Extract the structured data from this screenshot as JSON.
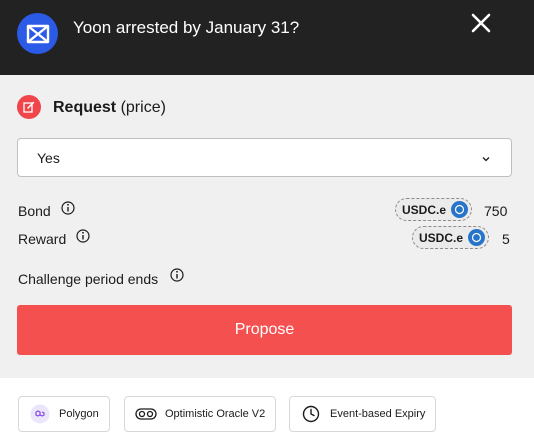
{
  "header": {
    "title": "Yoon arrested by January 31?",
    "logo_icon": "uma-logo-icon",
    "close_icon": "close-icon"
  },
  "request": {
    "label_bold": "Request",
    "label_rest": "(price)",
    "icon": "edit-icon"
  },
  "answer_select": {
    "value": "Yes",
    "icon": "chevron-down-icon"
  },
  "bond": {
    "label": "Bond",
    "token": "USDC.e",
    "amount": "750"
  },
  "reward": {
    "label": "Reward",
    "token": "USDC.e",
    "amount": "5"
  },
  "challenge": {
    "label": "Challenge period ends"
  },
  "propose_button": {
    "label": "Propose"
  },
  "footer": {
    "chips": [
      {
        "label": "Polygon",
        "icon": "polygon-icon"
      },
      {
        "label": "Optimistic Oracle V2",
        "icon": "oracle-icon"
      },
      {
        "label": "Event-based Expiry",
        "icon": "clock-icon"
      }
    ]
  },
  "colors": {
    "header_bg": "#222222",
    "logo_blue": "#2a5ae6",
    "accent_red": "#f4504f",
    "usdc_blue": "#2775ca",
    "panel_bg": "#f0f0f0"
  }
}
